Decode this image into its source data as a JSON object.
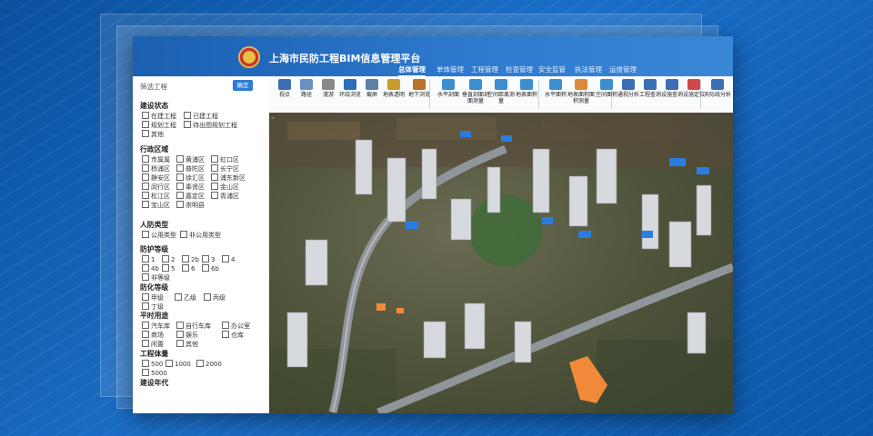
{
  "app": {
    "title": "上海市民防工程BIM信息管理平台"
  },
  "nav": {
    "tabs": [
      "总体管理",
      "单体管理",
      "工程管理",
      "检查管理",
      "安全监管",
      "执法管理",
      "运维管理"
    ]
  },
  "sidebar": {
    "header": "筛选工程",
    "confirm": "确定",
    "groups": [
      {
        "title": "建设状态",
        "options": [
          "在建工程",
          "已建工程",
          "规划工程",
          "待出图规划工程",
          "其他"
        ]
      },
      {
        "title": "行政区域",
        "options": [
          "市属属",
          "黄浦区",
          "虹口区",
          "杨浦区",
          "普陀区",
          "长宁区",
          "静安区",
          "徐汇区",
          "浦东新区",
          "闵行区",
          "奉贤区",
          "金山区",
          "松江区",
          "嘉定区",
          "青浦区",
          "宝山区",
          "崇明县"
        ]
      },
      {
        "title": "人防类型",
        "options": [
          "公用类型",
          "非公用类型"
        ]
      },
      {
        "title": "防护等级",
        "options": [
          "1",
          "2",
          "2b",
          "3",
          "4",
          "4b",
          "5",
          "6",
          "6b",
          "非等级"
        ]
      },
      {
        "title": "防化等级",
        "options": [
          "甲级",
          "乙级",
          "丙级",
          "丁级"
        ]
      },
      {
        "title": "平时用途",
        "options": [
          "汽车库",
          "自行车库",
          "办公室",
          "商场",
          "娱乐",
          "仓库",
          "闲置",
          "其他"
        ]
      },
      {
        "title": "工程体量",
        "options": [
          "500",
          "1000",
          "2000",
          "5000"
        ]
      },
      {
        "title": "建设年代",
        "options": []
      }
    ]
  },
  "toolbar": {
    "tools": [
      "视点",
      "路径",
      "漫游",
      "环绕浏览",
      "截屏",
      "地表透明",
      "地下浏览",
      "水平剖面",
      "垂直剖面剖面测量",
      "空间距离测量",
      "地表面积",
      "水平面积",
      "地表面积面积测量",
      "空间面积",
      "通视分析",
      "工程查询",
      "设施查询",
      "设施定位",
      "天际线分析"
    ]
  },
  "colors": {
    "accent": "#2d7bd4",
    "building_highlight": "#f08a3a",
    "building_blue": "#2a7de0"
  }
}
